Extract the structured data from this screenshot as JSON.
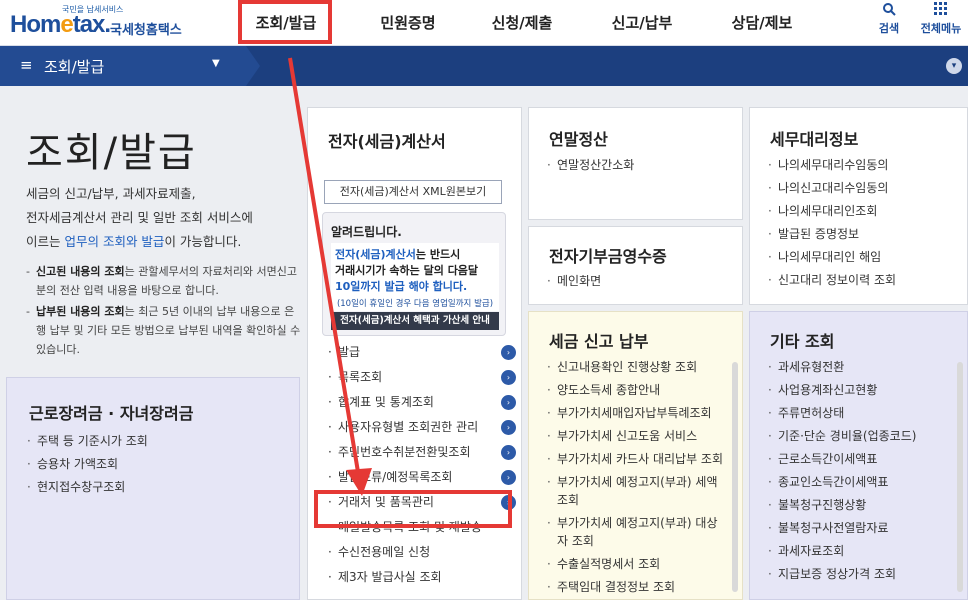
{
  "header": {
    "logo_sub": "국민을 납세서비스",
    "logo_main_a": "Hom",
    "logo_main_e": "e",
    "logo_main_b": "tax.",
    "logo_kr": "국세청홈택스",
    "nav": [
      "조회/발급",
      "민원증명",
      "신청/제출",
      "신고/납부",
      "상담/제보"
    ],
    "search_label": "검색",
    "menu_label": "전체메뉴"
  },
  "subbar": {
    "title": "조회/발급"
  },
  "hero": {
    "title": "조회/발급",
    "desc_1": "세금의 신고/납부, 과세자료제출,",
    "desc_2": "전자세금계산서 관리 및 일반 조회 서비스에",
    "desc_3a": "이르는 ",
    "desc_3b": "업무의 조회와 발급",
    "desc_3c": "이 가능합니다.",
    "note1_b": "신고된 내용의 조회",
    "note1": "는 관할세무서의 자료처리와 서면신고분의 전산 입력 내용을 바탕으로 합니다.",
    "note2_b": "납부된 내용의 조회",
    "note2": "는 최근 5년 이내의 납부 내용으로 은행 납부 및 기타 모든 방법으로 납부된 내역을 확인하실 수 있습니다."
  },
  "card_labor": {
    "title": "근로장려금 · 자녀장려금",
    "items": [
      "주택 등 기준시가 조회",
      "승용차 가액조회",
      "현지접수창구조회"
    ]
  },
  "card_einvoice": {
    "title": "전자(세금)계산서",
    "xml_button": "전자(세금)계산서 XML원본보기",
    "notice_title": "알려드립니다.",
    "notice_1b": "전자(세금)계산서",
    "notice_1": "는 반드시",
    "notice_2": "거래시기가 속하는 달의 다음달",
    "notice_3": "10일까지 발급 해야 합니다.",
    "notice_small": "(10일이 휴일인 경우 다음 영업일까지 발급)",
    "notice_bar": "전자(세금)계산서 혜택과 가산세 안내",
    "items": [
      "발급",
      "목록조회",
      "합계표 및 통계조회",
      "사용자유형별 조회권한 관리",
      "주민번호수취분전환및조회",
      "발급보류/예정목록조회",
      "거래처 및 품목관리",
      "메일발송목록 조회 및 재발송",
      "수신전용메일 신청",
      "제3자 발급사실 조회"
    ]
  },
  "card_yearend": {
    "title": "연말정산",
    "items": [
      "연말정산간소화"
    ]
  },
  "card_donation": {
    "title": "전자기부금영수증",
    "items": [
      "메인화면"
    ]
  },
  "card_tax": {
    "title": "세금 신고 납부",
    "items": [
      "신고내용확인 진행상황 조회",
      "양도소득세 종합안내",
      "부가가치세매입자납부특례조회",
      "부가가치세 신고도움 서비스",
      "부가가치세 카드사 대리납부 조회",
      "부가가치세 예정고지(부과) 세액조회",
      "부가가치세 예정고지(부과) 대상자 조회",
      "수출실적명세서 조회",
      "주택임대 결정정보 조회"
    ]
  },
  "card_agent": {
    "title": "세무대리정보",
    "items": [
      "나의세무대리수임동의",
      "나의신고대리수임동의",
      "나의세무대리인조회",
      "발급된 증명정보",
      "나의세무대리인 해임",
      "신고대리 정보이력 조회"
    ]
  },
  "card_other": {
    "title": "기타 조회",
    "items": [
      "과세유형전환",
      "사업용계좌신고현황",
      "주류면허상태",
      "기준·단순 경비율(업종코드)",
      "근로소득간이세액표",
      "종교인소득간이세액표",
      "불복청구진행상황",
      "불복청구사전열람자료",
      "과세자료조회",
      "지급보증 정상가격 조회"
    ]
  },
  "colors": {
    "navy": "#1c3f7f",
    "highlight": "#e53935",
    "link": "#1e5fbf"
  }
}
